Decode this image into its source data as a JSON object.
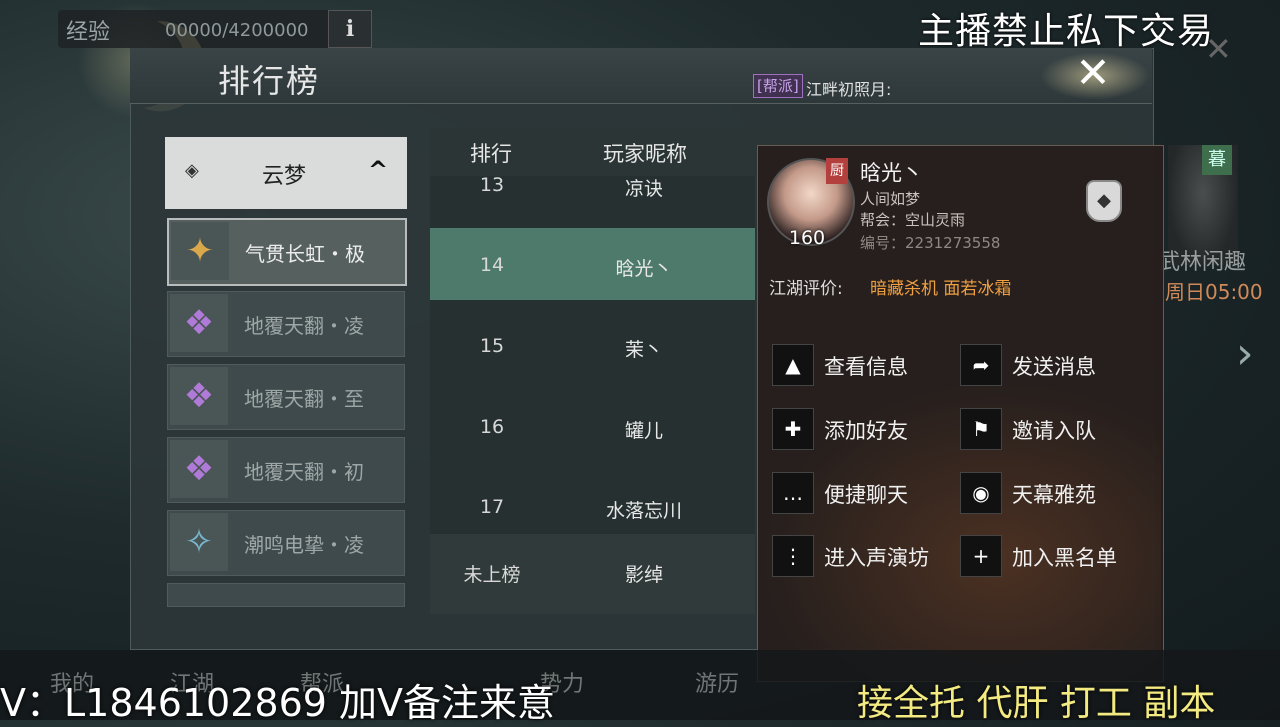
{
  "top": {
    "exp_label": "经验",
    "exp_value": "00000/4200000",
    "info_icon": "i",
    "banner": "主播禁止私下交易"
  },
  "panel": {
    "title": "排行榜",
    "guild_tag": "[帮派]",
    "guild_text": "江畔初照月:",
    "close": "✕"
  },
  "categories": {
    "header": "云梦",
    "header_arrow": "^",
    "items": [
      {
        "label": "气贯长虹・极",
        "icon": "✦",
        "color": "#d9a84a",
        "active": true
      },
      {
        "label": "地覆天翻・凌",
        "icon": "❖",
        "color": "#b07ad8",
        "active": false
      },
      {
        "label": "地覆天翻・至",
        "icon": "❖",
        "color": "#b07ad8",
        "active": false
      },
      {
        "label": "地覆天翻・初",
        "icon": "❖",
        "color": "#b07ad8",
        "active": false
      },
      {
        "label": "潮鸣电挚・凌",
        "icon": "✧",
        "color": "#7ab8d0",
        "active": false
      }
    ]
  },
  "table": {
    "headers": [
      "排行",
      "玩家昵称"
    ],
    "rows": [
      {
        "rank": "13",
        "name": "凉诀"
      },
      {
        "rank": "14",
        "name": "晗光丶"
      },
      {
        "rank": "15",
        "name": "茉丶"
      },
      {
        "rank": "16",
        "name": "罐儿"
      },
      {
        "rank": "17",
        "name": "水落忘川"
      }
    ],
    "my_row": {
      "rank": "未上榜",
      "name": "影绰"
    }
  },
  "player": {
    "name": "晗光丶",
    "subtitle": "人间如梦",
    "guild": "帮会：空山灵雨",
    "id": "编号：2231273558",
    "level": "160",
    "badge": "厨",
    "eval_label": "江湖评价:",
    "eval_value": "暗藏杀机 面若冰霜",
    "actions": [
      {
        "label": "查看信息",
        "icon": "▲"
      },
      {
        "label": "发送消息",
        "icon": "➦"
      },
      {
        "label": "添加好友",
        "icon": "✚"
      },
      {
        "label": "邀请入队",
        "icon": "⚑"
      },
      {
        "label": "便捷聊天",
        "icon": "…"
      },
      {
        "label": "天幕雅苑",
        "icon": "◉"
      },
      {
        "label": "进入声演坊",
        "icon": "⋮"
      },
      {
        "label": "加入黑名单",
        "icon": "+"
      }
    ]
  },
  "side": {
    "tag": "暮",
    "text1": "武林闲趣",
    "text2": "周日05:00"
  },
  "bottom_nav": [
    "我的",
    "江湖",
    "帮派",
    "势力",
    "游历"
  ],
  "overlay": {
    "contact": "V：L1846102869 加V备注来意",
    "services": "接全托 代肝 打工 副本"
  }
}
